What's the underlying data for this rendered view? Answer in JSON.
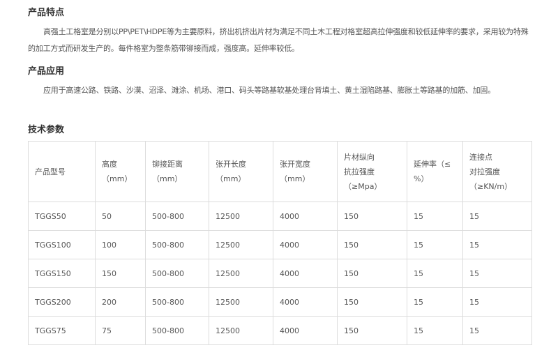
{
  "sections": [
    {
      "title": "产品特点",
      "text": "高强土工格室是分别以PP\\PET\\HDPE等为主要原料，挤出机挤出片材为满足不同土木工程对格室超高拉伸强度和较低延伸率的要求，采用较为特殊的加工方式而研发生产的。每件格室为整条筋带铆接而成，强度高。延伸率较低。"
    },
    {
      "title": "产品应用",
      "text": "应用于高速公路、铁路、沙漠、沼泽、滩涂、机场、港口、码头等路基软基处理台背填土、黄土湿陷路基、膨胀土等路基的加筋、加固。"
    },
    {
      "title": "技术参数"
    }
  ],
  "table": {
    "headers": [
      [
        "产品型号"
      ],
      [
        "高度",
        "（mm）"
      ],
      [
        "铆接距离",
        "（mm）"
      ],
      [
        "张开长度",
        "（mm）"
      ],
      [
        "张开宽度",
        "（mm）"
      ],
      [
        "片材纵向",
        "抗拉强度",
        "（≥Mpa）"
      ],
      [
        "延伸率（≤",
        "%）"
      ],
      [
        "连接点",
        "对拉强度",
        "（≥KN/m）"
      ]
    ],
    "rows": [
      [
        "TGGS50",
        "50",
        "500-800",
        "12500",
        "4000",
        "150",
        "15",
        "15"
      ],
      [
        "TGGS100",
        "100",
        "500-800",
        "12500",
        "4000",
        "150",
        "15",
        "15"
      ],
      [
        "TGGS150",
        "150",
        "500-800",
        "12500",
        "4000",
        "150",
        "15",
        "15"
      ],
      [
        "TGGS200",
        "200",
        "500-800",
        "12500",
        "4000",
        "150",
        "15",
        "15"
      ],
      [
        "TGGS75",
        "75",
        "500-800",
        "12500",
        "4000",
        "150",
        "15",
        "15"
      ]
    ]
  }
}
